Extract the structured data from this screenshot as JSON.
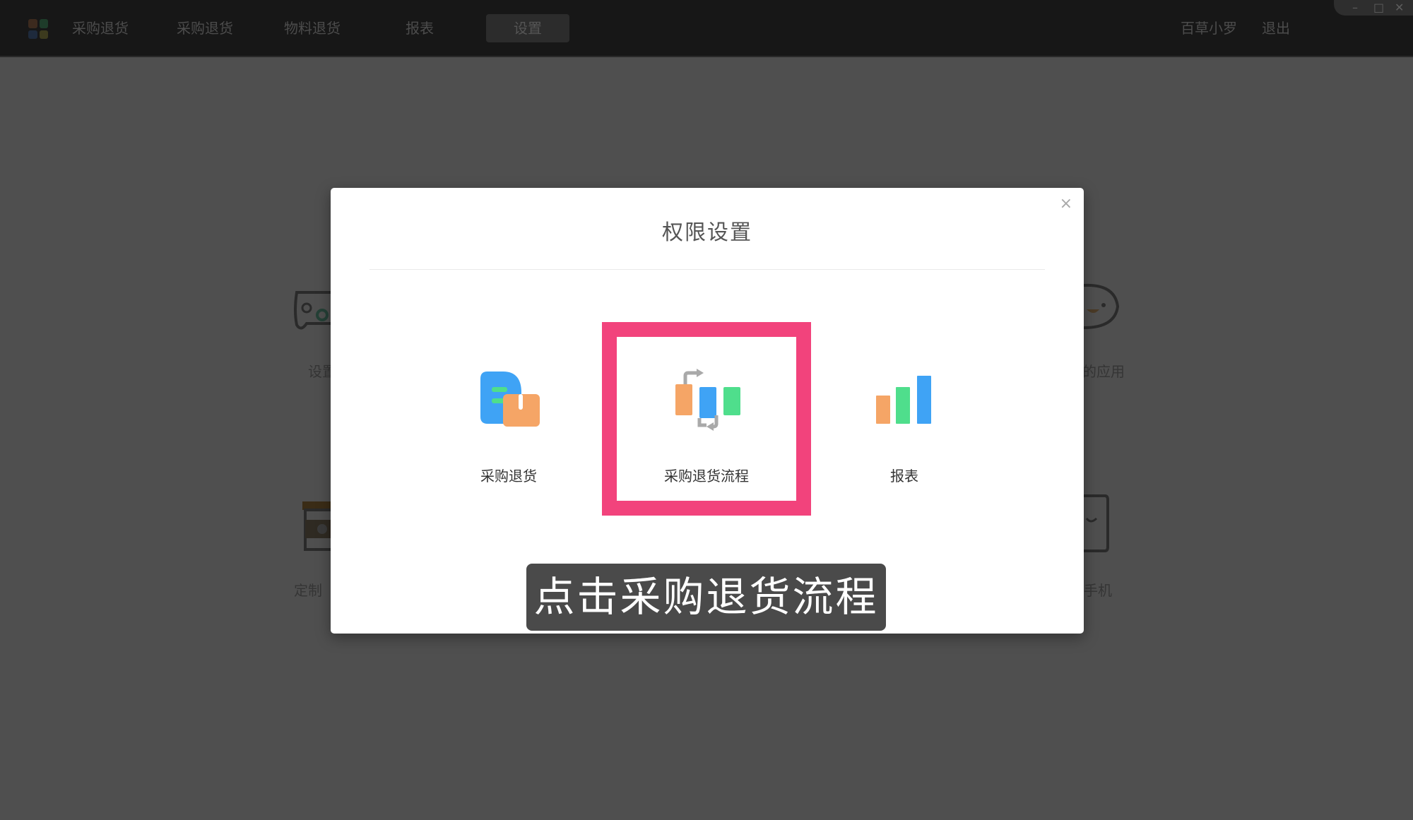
{
  "topbar": {
    "nav": [
      {
        "label": "采购退货"
      },
      {
        "label": "采购退货"
      },
      {
        "label": "物料退货"
      },
      {
        "label": "报表"
      },
      {
        "label": "设置"
      }
    ],
    "user": "百草小罗",
    "logout": "退出",
    "window_controls": {
      "minimize": "–",
      "maximize": "□",
      "close": "✕"
    }
  },
  "background": {
    "labels": [
      "设置",
      "定制",
      "的应用",
      "手机"
    ]
  },
  "modal": {
    "title": "权限设置",
    "close": "×",
    "items": [
      {
        "label": "采购退货",
        "icon": "purchase-return-icon"
      },
      {
        "label": "采购退货流程",
        "icon": "return-flow-icon"
      },
      {
        "label": "报表",
        "icon": "report-chart-icon"
      }
    ]
  },
  "subtitle": "点击采购退货流程",
  "colors": {
    "highlight": "#f2437c",
    "blue": "#3fa3f5",
    "orange": "#f5a566",
    "green": "#4fde8c"
  }
}
